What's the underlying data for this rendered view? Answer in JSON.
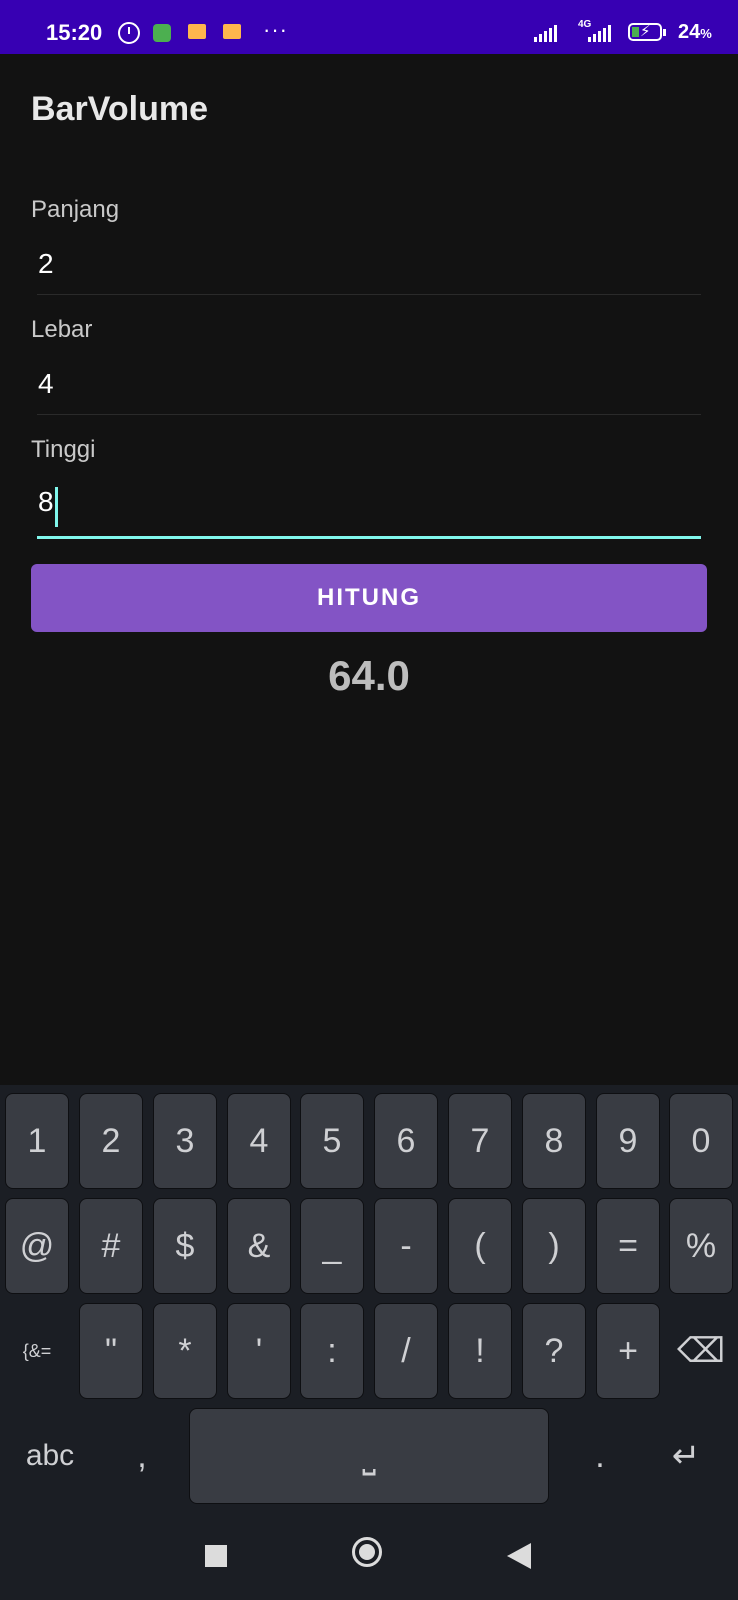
{
  "status_bar": {
    "time": "15:20",
    "dots": "···",
    "network": "4G",
    "battery": "24",
    "battery_unit": "%"
  },
  "app": {
    "title": "BarVolume"
  },
  "form": {
    "panjang_label": "Panjang",
    "panjang_value": "2",
    "lebar_label": "Lebar",
    "lebar_value": "4",
    "tinggi_label": "Tinggi",
    "tinggi_value": "8"
  },
  "button": {
    "label": "HITUNG"
  },
  "result": {
    "value": "64.0"
  },
  "keyboard": {
    "row1": [
      "1",
      "2",
      "3",
      "4",
      "5",
      "6",
      "7",
      "8",
      "9",
      "0"
    ],
    "row2": [
      "@",
      "#",
      "$",
      "&",
      "_",
      "-",
      "(",
      ")",
      "=",
      "%"
    ],
    "row3": [
      "{&=",
      "\"",
      "*",
      "'",
      ":",
      "/",
      "!",
      "?",
      "+"
    ],
    "abc": "abc",
    "comma": ",",
    "space": "⎵",
    "period": ".",
    "enter": "↵",
    "backspace": "⌫"
  },
  "colors": {
    "status_bar": "#3700b3",
    "button": "#8354c5",
    "accent": "#80f7ec",
    "background": "#121212"
  }
}
